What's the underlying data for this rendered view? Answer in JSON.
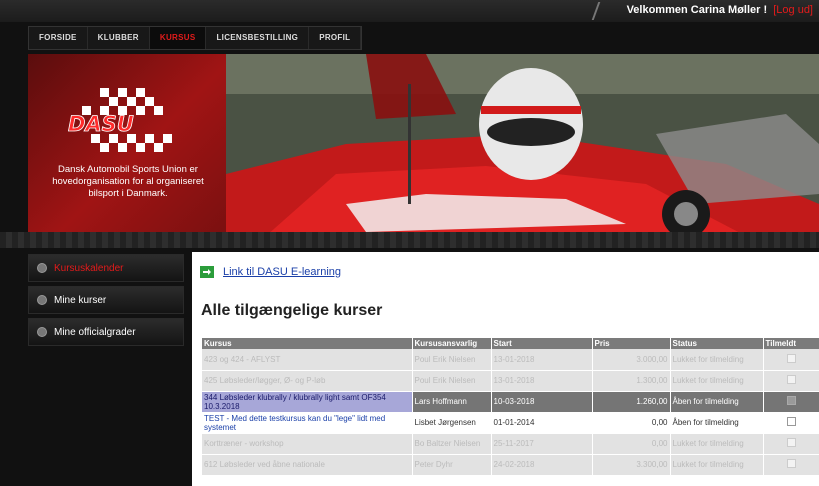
{
  "header": {
    "welcome": "Velkommen Carina Møller !",
    "logout": "[Log ud]"
  },
  "nav": {
    "items": [
      {
        "label": "FORSIDE"
      },
      {
        "label": "KLUBBER"
      },
      {
        "label": "KURSUS",
        "active": true
      },
      {
        "label": "LICENSBESTILLING"
      },
      {
        "label": "PROFIL"
      }
    ]
  },
  "banner": {
    "logo_text": "DASU",
    "tagline": "Dansk Automobil Sports Union er hovedorganisation for al organiseret bilsport i Danmark."
  },
  "sidebar": {
    "items": [
      {
        "label": "Kursuskalender",
        "active": true
      },
      {
        "label": "Mine kurser"
      },
      {
        "label": "Mine officialgrader"
      }
    ]
  },
  "main": {
    "elearning_link": "Link til DASU E-learning",
    "title": "Alle tilgængelige kurser",
    "table": {
      "headers": [
        "Kursus",
        "Kursusansvarlig",
        "Start",
        "Pris",
        "Status",
        "Tilmeldt"
      ],
      "rows": [
        {
          "kursus": "423 og 424 - AFLYST",
          "ansvarlig": "Poul Erik Nielsen",
          "start": "13-01-2018",
          "pris": "3.000,00",
          "status": "Lukket for tilmelding",
          "style": "closed"
        },
        {
          "kursus": "425 Løbsleder/løgger, Ø- og P-løb",
          "ansvarlig": "Poul Erik Nielsen",
          "start": "13-01-2018",
          "pris": "1.300,00",
          "status": "Lukket for tilmelding",
          "style": "closed"
        },
        {
          "kursus": "344 Løbsleder klubrally / klubrally light samt OF354 10.3.2018",
          "ansvarlig": "Lars Hoffmann",
          "start": "10-03-2018",
          "pris": "1.260,00",
          "status": "Åben for tilmelding",
          "style": "hl"
        },
        {
          "kursus": "TEST - Med dette testkursus kan du \"lege\" lidt med systemet",
          "ansvarlig": "Lisbet Jørgensen",
          "start": "01-01-2014",
          "pris": "0,00",
          "status": "Åben for tilmelding",
          "style": "open"
        },
        {
          "kursus": "Korttræner - workshop",
          "ansvarlig": "Bo Baltzer Nielsen",
          "start": "25-11-2017",
          "pris": "0,00",
          "status": "Lukket for tilmelding",
          "style": "closed"
        },
        {
          "kursus": "612 Løbsleder ved åbne nationale",
          "ansvarlig": "Peter Dyhr",
          "start": "24-02-2018",
          "pris": "3.300,00",
          "status": "Lukket for tilmelding",
          "style": "closed"
        }
      ]
    }
  },
  "colors": {
    "accent_red": "#e31b1b",
    "link_blue": "#1a3fa8",
    "icon_green": "#2b9d3b"
  }
}
